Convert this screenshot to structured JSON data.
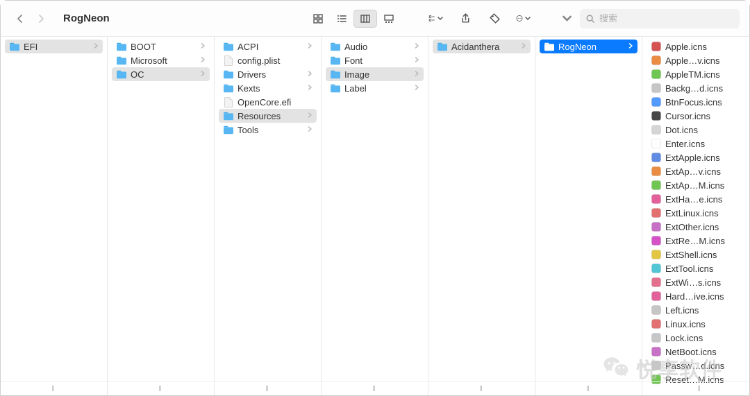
{
  "window_title": "RogNeon",
  "search": {
    "placeholder": "搜索"
  },
  "columns": [
    {
      "items": [
        {
          "name": "EFI",
          "type": "folder",
          "selected": "path"
        }
      ]
    },
    {
      "items": [
        {
          "name": "BOOT",
          "type": "folder"
        },
        {
          "name": "Microsoft",
          "type": "folder"
        },
        {
          "name": "OC",
          "type": "folder",
          "selected": "path"
        }
      ]
    },
    {
      "items": [
        {
          "name": "ACPI",
          "type": "folder"
        },
        {
          "name": "config.plist",
          "type": "file"
        },
        {
          "name": "Drivers",
          "type": "folder"
        },
        {
          "name": "Kexts",
          "type": "folder"
        },
        {
          "name": "OpenCore.efi",
          "type": "file"
        },
        {
          "name": "Resources",
          "type": "folder",
          "selected": "path"
        },
        {
          "name": "Tools",
          "type": "folder"
        }
      ]
    },
    {
      "items": [
        {
          "name": "Audio",
          "type": "folder"
        },
        {
          "name": "Font",
          "type": "folder"
        },
        {
          "name": "Image",
          "type": "folder",
          "selected": "path"
        },
        {
          "name": "Label",
          "type": "folder"
        }
      ]
    },
    {
      "items": [
        {
          "name": "Acidanthera",
          "type": "folder",
          "selected": "path"
        }
      ]
    },
    {
      "items": [
        {
          "name": "RogNeon",
          "type": "folder",
          "selected": "active"
        }
      ]
    },
    {
      "items": [
        {
          "name": "Apple.icns",
          "type": "icns",
          "color": "#d04040"
        },
        {
          "name": "Apple…v.icns",
          "type": "icns",
          "color": "#e88030"
        },
        {
          "name": "AppleTM.icns",
          "type": "icns",
          "color": "#60c040"
        },
        {
          "name": "Backg…d.icns",
          "type": "icns",
          "color": "#c0c0c0"
        },
        {
          "name": "BtnFocus.icns",
          "type": "icns",
          "color": "#4090ff"
        },
        {
          "name": "Cursor.icns",
          "type": "icns",
          "color": "#333333"
        },
        {
          "name": "Dot.icns",
          "type": "icns",
          "color": "#d0d0d0"
        },
        {
          "name": "Enter.icns",
          "type": "icns",
          "color": "#ffffff"
        },
        {
          "name": "ExtApple.icns",
          "type": "icns",
          "color": "#5080e0"
        },
        {
          "name": "ExtAp…v.icns",
          "type": "icns",
          "color": "#e88030"
        },
        {
          "name": "ExtAp…M.icns",
          "type": "icns",
          "color": "#60c040"
        },
        {
          "name": "ExtHa…e.icns",
          "type": "icns",
          "color": "#e05090"
        },
        {
          "name": "ExtLinux.icns",
          "type": "icns",
          "color": "#e06060"
        },
        {
          "name": "ExtOther.icns",
          "type": "icns",
          "color": "#c060c0"
        },
        {
          "name": "ExtRe…M.icns",
          "type": "icns",
          "color": "#d040c0"
        },
        {
          "name": "ExtShell.icns",
          "type": "icns",
          "color": "#e0c030"
        },
        {
          "name": "ExtTool.icns",
          "type": "icns",
          "color": "#40c0d0"
        },
        {
          "name": "ExtWi…s.icns",
          "type": "icns",
          "color": "#e06080"
        },
        {
          "name": "Hard…ive.icns",
          "type": "icns",
          "color": "#e05090"
        },
        {
          "name": "Left.icns",
          "type": "icns",
          "color": "#c0c0c0"
        },
        {
          "name": "Linux.icns",
          "type": "icns",
          "color": "#e06060"
        },
        {
          "name": "Lock.icns",
          "type": "icns",
          "color": "#c0c0c0"
        },
        {
          "name": "NetBoot.icns",
          "type": "icns",
          "color": "#c060c0"
        },
        {
          "name": "Passw…d.icns",
          "type": "icns",
          "color": "#c0c0c0"
        },
        {
          "name": "Reset…M.icns",
          "type": "icns",
          "color": "#60c040"
        }
      ]
    }
  ],
  "watermark": "悦享软件"
}
